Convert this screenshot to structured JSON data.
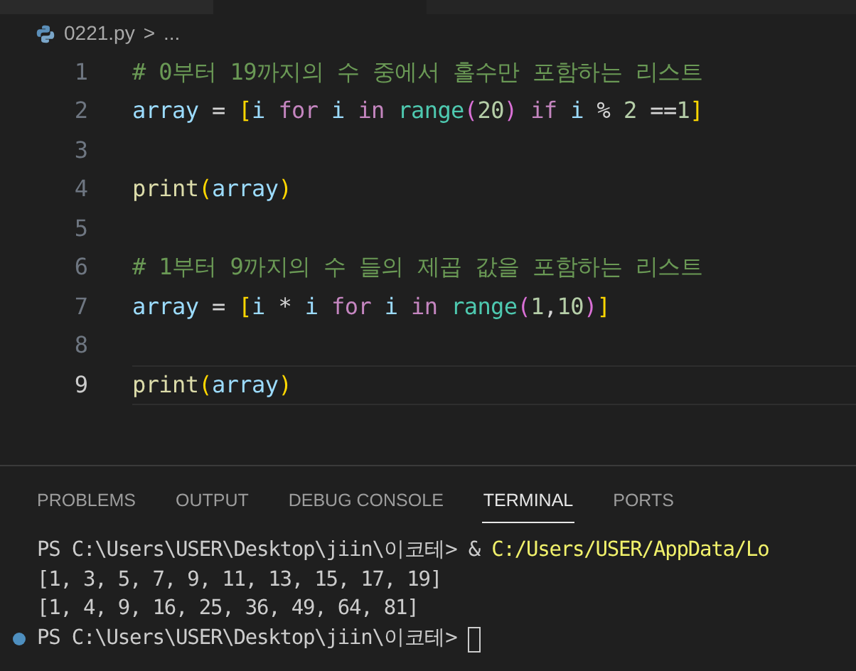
{
  "breadcrumb": {
    "file": "0221.py",
    "separator": ">",
    "more": "..."
  },
  "editor": {
    "lines": [
      {
        "number": "1",
        "active": false,
        "tokens": [
          {
            "t": "# 0부터 19까지의 수 중에서 홀수만 포함하는 리스트",
            "kind": "comment"
          }
        ]
      },
      {
        "number": "2",
        "active": false,
        "tokens": [
          {
            "t": "array",
            "kind": "variable"
          },
          {
            "t": " = ",
            "kind": "operator"
          },
          {
            "t": "[",
            "kind": "bracket1"
          },
          {
            "t": "i",
            "kind": "variable"
          },
          {
            "t": " for ",
            "kind": "keyword"
          },
          {
            "t": "i",
            "kind": "variable"
          },
          {
            "t": " in ",
            "kind": "keyword"
          },
          {
            "t": "range",
            "kind": "builtin"
          },
          {
            "t": "(",
            "kind": "bracket2"
          },
          {
            "t": "20",
            "kind": "number"
          },
          {
            "t": ")",
            "kind": "bracket2"
          },
          {
            "t": " if ",
            "kind": "keyword"
          },
          {
            "t": "i",
            "kind": "variable"
          },
          {
            "t": " % ",
            "kind": "operator"
          },
          {
            "t": "2",
            "kind": "number"
          },
          {
            "t": " ==",
            "kind": "operator"
          },
          {
            "t": "1",
            "kind": "number"
          },
          {
            "t": "]",
            "kind": "bracket1"
          }
        ]
      },
      {
        "number": "3",
        "active": false
      },
      {
        "number": "4",
        "active": false,
        "tokens": [
          {
            "t": "print",
            "kind": "function"
          },
          {
            "t": "(",
            "kind": "bracket1"
          },
          {
            "t": "array",
            "kind": "variable"
          },
          {
            "t": ")",
            "kind": "bracket1"
          }
        ]
      },
      {
        "number": "5",
        "active": false
      },
      {
        "number": "6",
        "active": false,
        "tokens": [
          {
            "t": "# 1부터 9까지의 수 들의 제곱 값을 포함하는 리스트",
            "kind": "comment"
          }
        ]
      },
      {
        "number": "7",
        "active": false,
        "tokens": [
          {
            "t": "array",
            "kind": "variable"
          },
          {
            "t": " = ",
            "kind": "operator"
          },
          {
            "t": "[",
            "kind": "bracket1"
          },
          {
            "t": "i",
            "kind": "variable"
          },
          {
            "t": " * ",
            "kind": "operator"
          },
          {
            "t": "i",
            "kind": "variable"
          },
          {
            "t": " for ",
            "kind": "keyword"
          },
          {
            "t": "i",
            "kind": "variable"
          },
          {
            "t": " in ",
            "kind": "keyword"
          },
          {
            "t": "range",
            "kind": "builtin"
          },
          {
            "t": "(",
            "kind": "bracket2"
          },
          {
            "t": "1",
            "kind": "number"
          },
          {
            "t": ",",
            "kind": "operator"
          },
          {
            "t": "10",
            "kind": "number"
          },
          {
            "t": ")",
            "kind": "bracket2"
          },
          {
            "t": "]",
            "kind": "bracket1"
          }
        ]
      },
      {
        "number": "8",
        "active": false
      },
      {
        "number": "9",
        "active": true,
        "tokens": [
          {
            "t": "print",
            "kind": "function"
          },
          {
            "t": "(",
            "kind": "bracket1"
          },
          {
            "t": "array",
            "kind": "variable"
          },
          {
            "t": ")",
            "kind": "bracket1"
          }
        ]
      }
    ]
  },
  "panel": {
    "tabs": [
      {
        "label": "PROBLEMS",
        "selected": false
      },
      {
        "label": "OUTPUT",
        "selected": false
      },
      {
        "label": "DEBUG CONSOLE",
        "selected": false
      },
      {
        "label": "TERMINAL",
        "selected": true
      },
      {
        "label": "PORTS",
        "selected": false
      }
    ],
    "terminal": [
      {
        "dot": false,
        "cursor": false,
        "segments": [
          {
            "t": "PS C:\\Users\\USER\\Desktop\\jiin\\이코테> & ",
            "kind": "plain"
          },
          {
            "t": "C:/Users/USER/AppData/Lo",
            "kind": "path"
          }
        ]
      },
      {
        "dot": false,
        "cursor": false,
        "segments": [
          {
            "t": "[1, 3, 5, 7, 9, 11, 13, 15, 17, 19]",
            "kind": "plain"
          }
        ]
      },
      {
        "dot": false,
        "cursor": false,
        "segments": [
          {
            "t": "[1, 4, 9, 16, 25, 36, 49, 64, 81]",
            "kind": "plain"
          }
        ]
      },
      {
        "dot": true,
        "cursor": true,
        "segments": [
          {
            "t": "PS C:\\Users\\USER\\Desktop\\jiin\\이코테> ",
            "kind": "plain"
          }
        ]
      }
    ]
  }
}
